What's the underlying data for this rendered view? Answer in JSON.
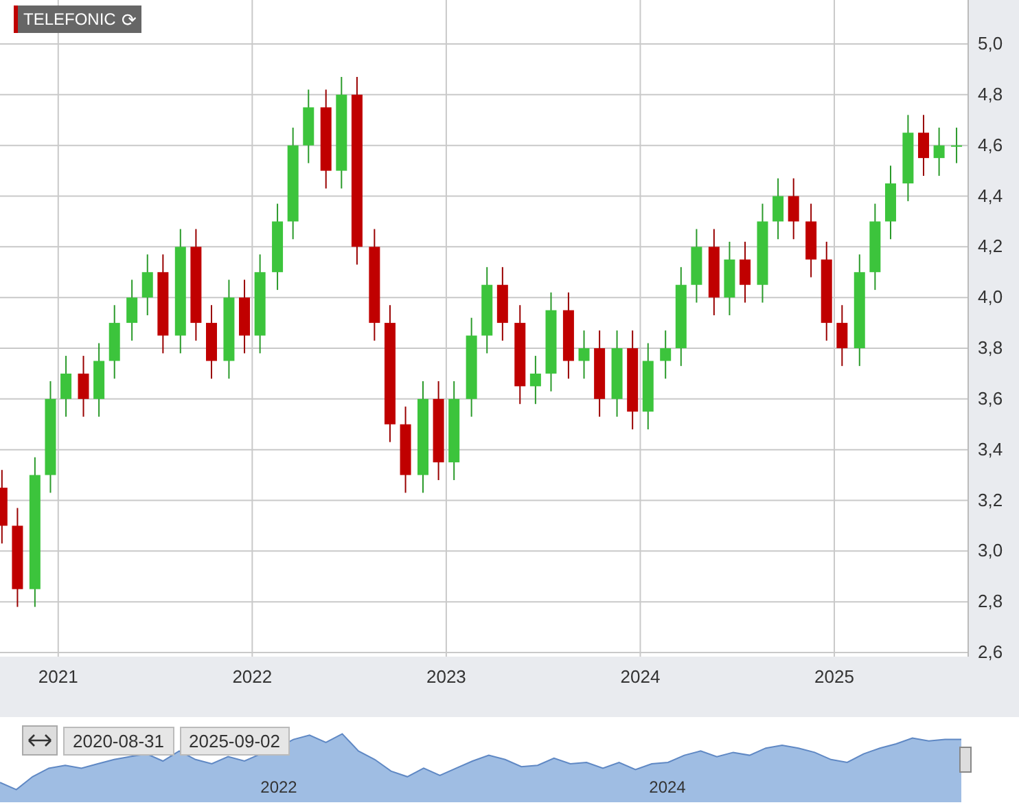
{
  "legend": {
    "label": "TELEFONIC",
    "refresh_icon": "⟳"
  },
  "chart_data": {
    "type": "candlestick",
    "grid": true,
    "xlim": [
      2020.7,
      2025.69
    ],
    "ylim": [
      2.6,
      5.0
    ],
    "xticks": [
      2021,
      2022,
      2023,
      2024,
      2025
    ],
    "yticks": [
      {
        "value": 2.6,
        "label": "2,6"
      },
      {
        "value": 2.8,
        "label": "2,8"
      },
      {
        "value": 3.0,
        "label": "3,0"
      },
      {
        "value": 3.2,
        "label": "3,2"
      },
      {
        "value": 3.4,
        "label": "3,4"
      },
      {
        "value": 3.6,
        "label": "3,6"
      },
      {
        "value": 3.8,
        "label": "3,8"
      },
      {
        "value": 4.0,
        "label": "4,0"
      },
      {
        "value": 4.2,
        "label": "4,2"
      },
      {
        "value": 4.4,
        "label": "4,4"
      },
      {
        "value": 4.6,
        "label": "4,6"
      },
      {
        "value": 4.8,
        "label": "4,8"
      },
      {
        "value": 5.0,
        "label": "5,0"
      }
    ],
    "x": [
      2020.71,
      2020.79,
      2020.88,
      2020.96,
      2021.04,
      2021.13,
      2021.21,
      2021.29,
      2021.38,
      2021.46,
      2021.54,
      2021.63,
      2021.71,
      2021.79,
      2021.88,
      2021.96,
      2022.04,
      2022.13,
      2022.21,
      2022.29,
      2022.38,
      2022.46,
      2022.54,
      2022.63,
      2022.71,
      2022.79,
      2022.88,
      2022.96,
      2023.04,
      2023.13,
      2023.21,
      2023.29,
      2023.38,
      2023.46,
      2023.54,
      2023.63,
      2023.71,
      2023.79,
      2023.88,
      2023.96,
      2024.04,
      2024.13,
      2024.21,
      2024.29,
      2024.38,
      2024.46,
      2024.54,
      2024.63,
      2024.71,
      2024.79,
      2024.88,
      2024.96,
      2025.04,
      2025.13,
      2025.21,
      2025.29,
      2025.38,
      2025.46,
      2025.54,
      2025.63
    ],
    "ohlc": [
      [
        3.25,
        3.32,
        3.03,
        3.1
      ],
      [
        3.1,
        3.17,
        2.78,
        2.85
      ],
      [
        2.85,
        3.37,
        2.78,
        3.3
      ],
      [
        3.3,
        3.67,
        3.23,
        3.6
      ],
      [
        3.6,
        3.77,
        3.53,
        3.7
      ],
      [
        3.7,
        3.77,
        3.53,
        3.6
      ],
      [
        3.6,
        3.82,
        3.53,
        3.75
      ],
      [
        3.75,
        3.97,
        3.68,
        3.9
      ],
      [
        3.9,
        4.07,
        3.83,
        4.0
      ],
      [
        4.0,
        4.17,
        3.93,
        4.1
      ],
      [
        4.1,
        4.17,
        3.78,
        3.85
      ],
      [
        3.85,
        4.27,
        3.78,
        4.2
      ],
      [
        4.2,
        4.27,
        3.83,
        3.9
      ],
      [
        3.9,
        3.97,
        3.68,
        3.75
      ],
      [
        3.75,
        4.07,
        3.68,
        4.0
      ],
      [
        4.0,
        4.07,
        3.78,
        3.85
      ],
      [
        3.85,
        4.17,
        3.78,
        4.1
      ],
      [
        4.1,
        4.37,
        4.03,
        4.3
      ],
      [
        4.3,
        4.67,
        4.23,
        4.6
      ],
      [
        4.6,
        4.82,
        4.53,
        4.75
      ],
      [
        4.75,
        4.82,
        4.43,
        4.5
      ],
      [
        4.5,
        4.87,
        4.43,
        4.8
      ],
      [
        4.8,
        4.87,
        4.13,
        4.2
      ],
      [
        4.2,
        4.27,
        3.83,
        3.9
      ],
      [
        3.9,
        3.97,
        3.43,
        3.5
      ],
      [
        3.5,
        3.57,
        3.23,
        3.3
      ],
      [
        3.3,
        3.67,
        3.23,
        3.6
      ],
      [
        3.6,
        3.67,
        3.28,
        3.35
      ],
      [
        3.35,
        3.67,
        3.28,
        3.6
      ],
      [
        3.6,
        3.92,
        3.53,
        3.85
      ],
      [
        3.85,
        4.12,
        3.78,
        4.05
      ],
      [
        4.05,
        4.12,
        3.83,
        3.9
      ],
      [
        3.9,
        3.97,
        3.58,
        3.65
      ],
      [
        3.65,
        3.77,
        3.58,
        3.7
      ],
      [
        3.7,
        4.02,
        3.63,
        3.95
      ],
      [
        3.95,
        4.02,
        3.68,
        3.75
      ],
      [
        3.75,
        3.87,
        3.68,
        3.8
      ],
      [
        3.8,
        3.87,
        3.53,
        3.6
      ],
      [
        3.6,
        3.87,
        3.53,
        3.8
      ],
      [
        3.8,
        3.87,
        3.48,
        3.55
      ],
      [
        3.55,
        3.82,
        3.48,
        3.75
      ],
      [
        3.75,
        3.87,
        3.68,
        3.8
      ],
      [
        3.8,
        4.12,
        3.73,
        4.05
      ],
      [
        4.05,
        4.27,
        3.98,
        4.2
      ],
      [
        4.2,
        4.27,
        3.93,
        4.0
      ],
      [
        4.0,
        4.22,
        3.93,
        4.15
      ],
      [
        4.15,
        4.22,
        3.98,
        4.05
      ],
      [
        4.05,
        4.37,
        3.98,
        4.3
      ],
      [
        4.3,
        4.47,
        4.23,
        4.4
      ],
      [
        4.4,
        4.47,
        4.23,
        4.3
      ],
      [
        4.3,
        4.37,
        4.08,
        4.15
      ],
      [
        4.15,
        4.22,
        3.83,
        3.9
      ],
      [
        3.9,
        3.97,
        3.73,
        3.8
      ],
      [
        3.8,
        4.17,
        3.73,
        4.1
      ],
      [
        4.1,
        4.37,
        4.03,
        4.3
      ],
      [
        4.3,
        4.52,
        4.23,
        4.45
      ],
      [
        4.45,
        4.72,
        4.38,
        4.65
      ],
      [
        4.65,
        4.72,
        4.48,
        4.55
      ],
      [
        4.55,
        4.67,
        4.48,
        4.6
      ],
      [
        4.6,
        4.67,
        4.53,
        4.6
      ]
    ]
  },
  "navigator": {
    "from": "2020-08-31",
    "to": "2025-09-02",
    "labels": [
      "2022",
      "2024"
    ]
  }
}
